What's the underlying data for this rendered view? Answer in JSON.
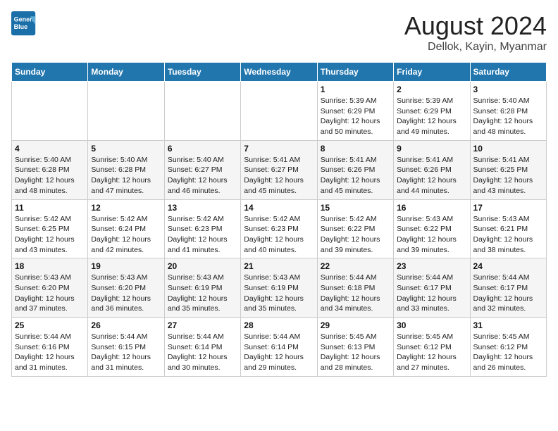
{
  "logo": {
    "line1": "General",
    "line2": "Blue"
  },
  "title": "August 2024",
  "location": "Dellok, Kayin, Myanmar",
  "weekdays": [
    "Sunday",
    "Monday",
    "Tuesday",
    "Wednesday",
    "Thursday",
    "Friday",
    "Saturday"
  ],
  "weeks": [
    [
      {
        "day": "",
        "info": ""
      },
      {
        "day": "",
        "info": ""
      },
      {
        "day": "",
        "info": ""
      },
      {
        "day": "",
        "info": ""
      },
      {
        "day": "1",
        "info": "Sunrise: 5:39 AM\nSunset: 6:29 PM\nDaylight: 12 hours\nand 50 minutes."
      },
      {
        "day": "2",
        "info": "Sunrise: 5:39 AM\nSunset: 6:29 PM\nDaylight: 12 hours\nand 49 minutes."
      },
      {
        "day": "3",
        "info": "Sunrise: 5:40 AM\nSunset: 6:28 PM\nDaylight: 12 hours\nand 48 minutes."
      }
    ],
    [
      {
        "day": "4",
        "info": "Sunrise: 5:40 AM\nSunset: 6:28 PM\nDaylight: 12 hours\nand 48 minutes."
      },
      {
        "day": "5",
        "info": "Sunrise: 5:40 AM\nSunset: 6:28 PM\nDaylight: 12 hours\nand 47 minutes."
      },
      {
        "day": "6",
        "info": "Sunrise: 5:40 AM\nSunset: 6:27 PM\nDaylight: 12 hours\nand 46 minutes."
      },
      {
        "day": "7",
        "info": "Sunrise: 5:41 AM\nSunset: 6:27 PM\nDaylight: 12 hours\nand 45 minutes."
      },
      {
        "day": "8",
        "info": "Sunrise: 5:41 AM\nSunset: 6:26 PM\nDaylight: 12 hours\nand 45 minutes."
      },
      {
        "day": "9",
        "info": "Sunrise: 5:41 AM\nSunset: 6:26 PM\nDaylight: 12 hours\nand 44 minutes."
      },
      {
        "day": "10",
        "info": "Sunrise: 5:41 AM\nSunset: 6:25 PM\nDaylight: 12 hours\nand 43 minutes."
      }
    ],
    [
      {
        "day": "11",
        "info": "Sunrise: 5:42 AM\nSunset: 6:25 PM\nDaylight: 12 hours\nand 43 minutes."
      },
      {
        "day": "12",
        "info": "Sunrise: 5:42 AM\nSunset: 6:24 PM\nDaylight: 12 hours\nand 42 minutes."
      },
      {
        "day": "13",
        "info": "Sunrise: 5:42 AM\nSunset: 6:23 PM\nDaylight: 12 hours\nand 41 minutes."
      },
      {
        "day": "14",
        "info": "Sunrise: 5:42 AM\nSunset: 6:23 PM\nDaylight: 12 hours\nand 40 minutes."
      },
      {
        "day": "15",
        "info": "Sunrise: 5:42 AM\nSunset: 6:22 PM\nDaylight: 12 hours\nand 39 minutes."
      },
      {
        "day": "16",
        "info": "Sunrise: 5:43 AM\nSunset: 6:22 PM\nDaylight: 12 hours\nand 39 minutes."
      },
      {
        "day": "17",
        "info": "Sunrise: 5:43 AM\nSunset: 6:21 PM\nDaylight: 12 hours\nand 38 minutes."
      }
    ],
    [
      {
        "day": "18",
        "info": "Sunrise: 5:43 AM\nSunset: 6:20 PM\nDaylight: 12 hours\nand 37 minutes."
      },
      {
        "day": "19",
        "info": "Sunrise: 5:43 AM\nSunset: 6:20 PM\nDaylight: 12 hours\nand 36 minutes."
      },
      {
        "day": "20",
        "info": "Sunrise: 5:43 AM\nSunset: 6:19 PM\nDaylight: 12 hours\nand 35 minutes."
      },
      {
        "day": "21",
        "info": "Sunrise: 5:43 AM\nSunset: 6:19 PM\nDaylight: 12 hours\nand 35 minutes."
      },
      {
        "day": "22",
        "info": "Sunrise: 5:44 AM\nSunset: 6:18 PM\nDaylight: 12 hours\nand 34 minutes."
      },
      {
        "day": "23",
        "info": "Sunrise: 5:44 AM\nSunset: 6:17 PM\nDaylight: 12 hours\nand 33 minutes."
      },
      {
        "day": "24",
        "info": "Sunrise: 5:44 AM\nSunset: 6:17 PM\nDaylight: 12 hours\nand 32 minutes."
      }
    ],
    [
      {
        "day": "25",
        "info": "Sunrise: 5:44 AM\nSunset: 6:16 PM\nDaylight: 12 hours\nand 31 minutes."
      },
      {
        "day": "26",
        "info": "Sunrise: 5:44 AM\nSunset: 6:15 PM\nDaylight: 12 hours\nand 31 minutes."
      },
      {
        "day": "27",
        "info": "Sunrise: 5:44 AM\nSunset: 6:14 PM\nDaylight: 12 hours\nand 30 minutes."
      },
      {
        "day": "28",
        "info": "Sunrise: 5:44 AM\nSunset: 6:14 PM\nDaylight: 12 hours\nand 29 minutes."
      },
      {
        "day": "29",
        "info": "Sunrise: 5:45 AM\nSunset: 6:13 PM\nDaylight: 12 hours\nand 28 minutes."
      },
      {
        "day": "30",
        "info": "Sunrise: 5:45 AM\nSunset: 6:12 PM\nDaylight: 12 hours\nand 27 minutes."
      },
      {
        "day": "31",
        "info": "Sunrise: 5:45 AM\nSunset: 6:12 PM\nDaylight: 12 hours\nand 26 minutes."
      }
    ]
  ]
}
